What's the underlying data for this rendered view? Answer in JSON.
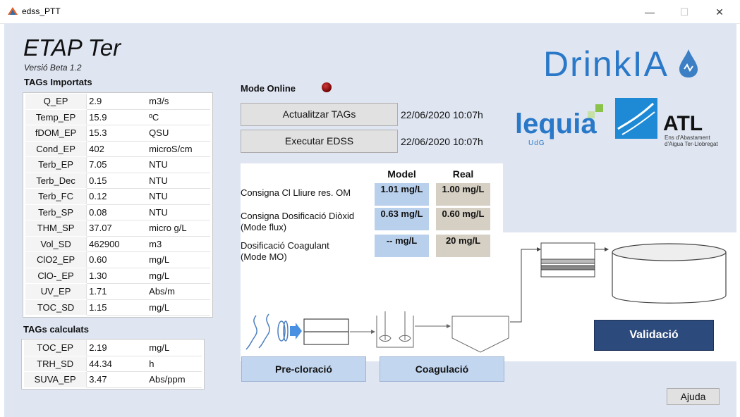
{
  "window": {
    "title": "edss_PTT",
    "minimize": "—",
    "maximize": "☐",
    "close": "✕"
  },
  "app": {
    "title": "ETAP Ter",
    "version": "Versió Beta 1.2"
  },
  "imported": {
    "label": "TAGs Importats",
    "rows": [
      {
        "name": "Q_EP",
        "value": "2.9",
        "unit": "m3/s"
      },
      {
        "name": "Temp_EP",
        "value": "15.9",
        "unit": "ºC"
      },
      {
        "name": "fDOM_EP",
        "value": "15.3",
        "unit": "QSU"
      },
      {
        "name": "Cond_EP",
        "value": "402",
        "unit": "microS/cm"
      },
      {
        "name": "Terb_EP",
        "value": "7.05",
        "unit": "NTU"
      },
      {
        "name": "Terb_Dec",
        "value": "0.15",
        "unit": "NTU"
      },
      {
        "name": "Terb_FC",
        "value": "0.12",
        "unit": "NTU"
      },
      {
        "name": "Terb_SP",
        "value": "0.08",
        "unit": "NTU"
      },
      {
        "name": "THM_SP",
        "value": "37.07",
        "unit": "micro g/L"
      },
      {
        "name": "Vol_SD",
        "value": "462900",
        "unit": "m3"
      },
      {
        "name": "ClO2_EP",
        "value": "0.60",
        "unit": "mg/L"
      },
      {
        "name": "ClO-_EP",
        "value": "1.30",
        "unit": "mg/L"
      },
      {
        "name": "UV_EP",
        "value": "1.71",
        "unit": "Abs/m"
      },
      {
        "name": "TOC_SD",
        "value": "1.15",
        "unit": "mg/L"
      }
    ]
  },
  "calculated": {
    "label": "TAGs calculats",
    "rows": [
      {
        "name": "TOC_EP",
        "value": "2.19",
        "unit": "mg/L"
      },
      {
        "name": "TRH_SD",
        "value": "44.34",
        "unit": "h"
      },
      {
        "name": "SUVA_EP",
        "value": "3.47",
        "unit": "Abs/ppm"
      }
    ]
  },
  "online": {
    "label": "Mode Online",
    "led_color": "#8b0000",
    "update_button": "Actualitzar TAGs",
    "update_time": "22/06/2020 10:07h",
    "run_button": "Executar EDSS",
    "run_time": "22/06/2020 10:07h"
  },
  "dosing": {
    "model_header": "Model",
    "real_header": "Real",
    "rows": [
      {
        "label_line1": "Consigna Cl Lliure res. OM",
        "label_line2": "",
        "model": "1.01 mg/L",
        "real": "1.00 mg/L"
      },
      {
        "label_line1": "Consigna Dosificació Diòxid",
        "label_line2": "(Mode flux)",
        "model": "0.63 mg/L",
        "real": "0.60 mg/L"
      },
      {
        "label_line1": "Dosificació Coagulant",
        "label_line2": "(Mode MO)",
        "model": "-- mg/L",
        "real": "20 mg/L"
      }
    ]
  },
  "process": {
    "precloration_button": "Pre-cloració",
    "coagulation_button": "Coagulació",
    "validation_button": "Validació"
  },
  "help_button": "Ajuda",
  "logos": {
    "drinkia": "DrinkIA",
    "lequia": "lequia",
    "udg": "UdG",
    "atl": "ATL",
    "atl_sub1": "Ens d'Abastament",
    "atl_sub2": "d'Aigua Ter-Llobregat"
  },
  "colors": {
    "background": "#dfe6f2",
    "model_cell": "#b9d0ec",
    "real_cell": "#d6d0c4",
    "validate": "#2d4a7c",
    "accent_blue": "#2a78c8"
  }
}
